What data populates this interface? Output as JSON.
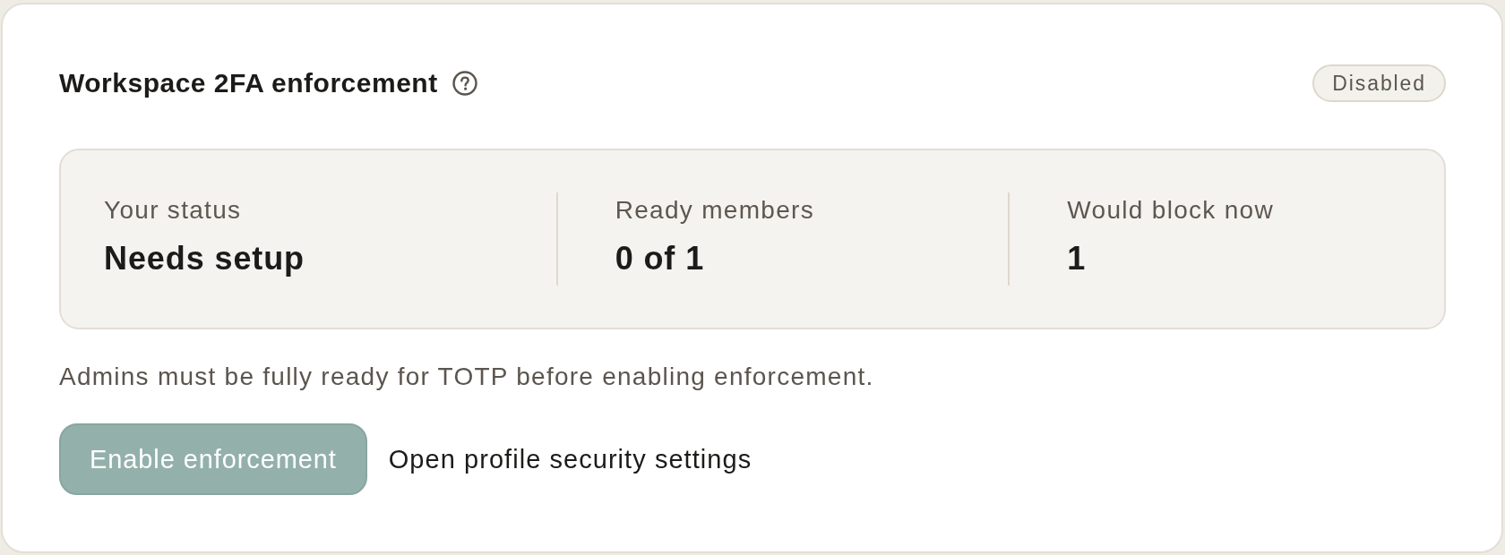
{
  "card": {
    "title": "Workspace 2FA enforcement",
    "status_badge": "Disabled"
  },
  "stats": [
    {
      "label": "Your status",
      "value": "Needs setup"
    },
    {
      "label": "Ready members",
      "value": "0 of 1"
    },
    {
      "label": "Would block now",
      "value": "1"
    }
  ],
  "note": "Admins must be fully ready for TOTP before enabling enforcement.",
  "actions": [
    {
      "kind": "button",
      "label": "Enable enforcement",
      "disabled": true
    },
    {
      "kind": "link",
      "label": "Open profile security settings",
      "disabled": false
    }
  ]
}
